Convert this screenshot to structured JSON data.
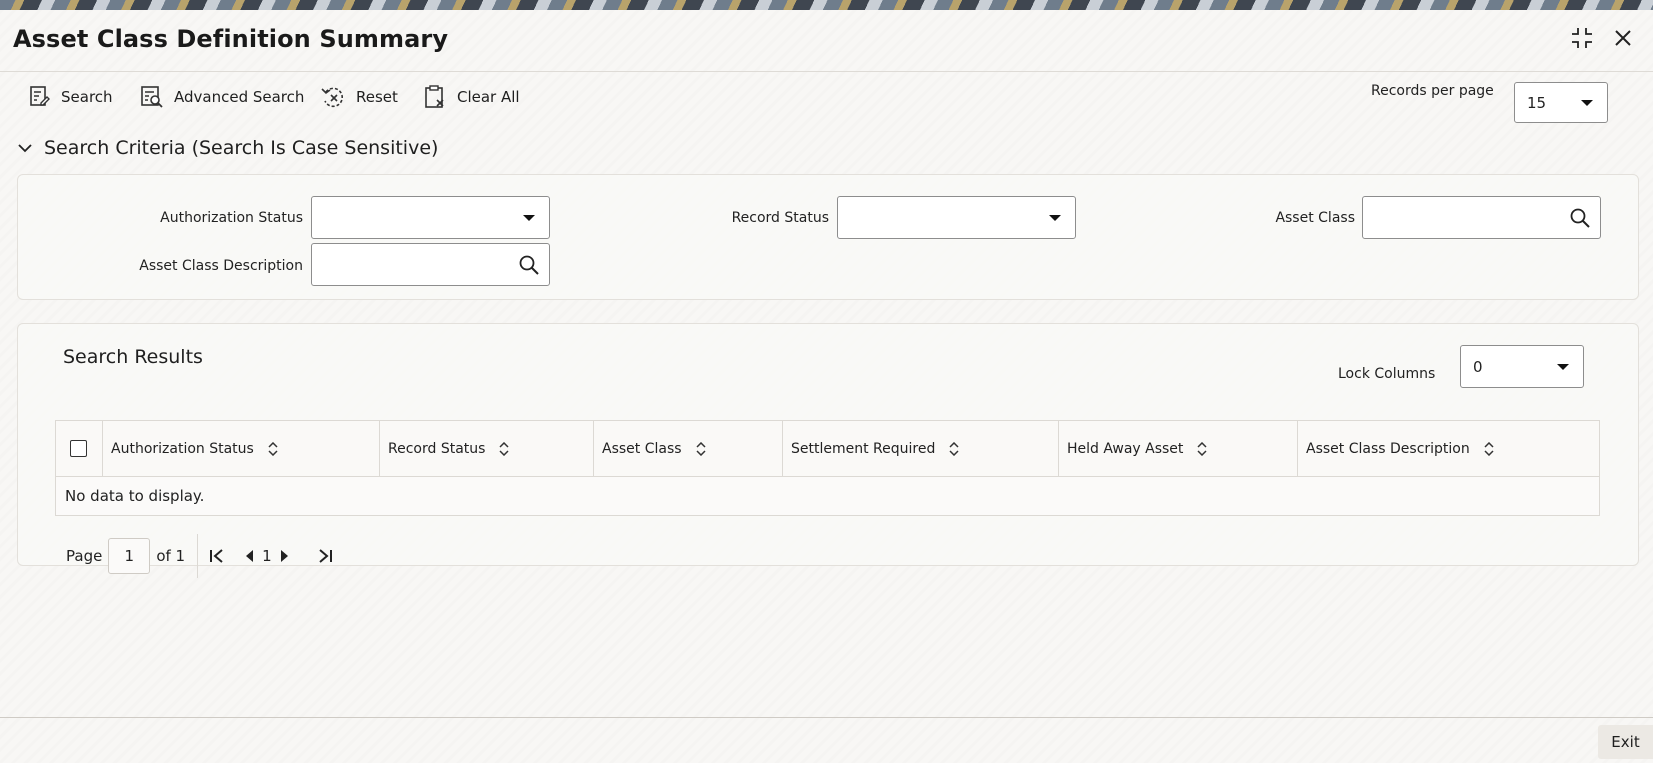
{
  "window": {
    "title": "Asset Class Definition Summary"
  },
  "toolbar": {
    "search_label": "Search",
    "advanced_search_label": "Advanced Search",
    "reset_label": "Reset",
    "clear_all_label": "Clear All",
    "records_per_page_label": "Records per page",
    "records_per_page_value": "15"
  },
  "criteria": {
    "heading": "Search Criteria (Search Is Case Sensitive)",
    "authorization_status_label": "Authorization Status",
    "authorization_status_value": "",
    "record_status_label": "Record Status",
    "record_status_value": "",
    "asset_class_label": "Asset Class",
    "asset_class_value": "",
    "asset_class_description_label": "Asset Class Description",
    "asset_class_description_value": ""
  },
  "results": {
    "heading": "Search Results",
    "lock_columns_label": "Lock Columns",
    "lock_columns_value": "0",
    "columns": [
      "Authorization Status",
      "Record Status",
      "Asset Class",
      "Settlement Required",
      "Held Away Asset",
      "Asset Class Description"
    ],
    "rows": [],
    "empty_message": "No data to display."
  },
  "pagination": {
    "page_label": "Page",
    "current_page": "1",
    "of_label": "of 1",
    "nav_page": "1"
  },
  "footer": {
    "exit_label": "Exit"
  },
  "icons": {
    "search": "search-icon",
    "advanced_search": "advanced-search-icon",
    "reset": "reset-icon",
    "clear_all": "clear-all-icon",
    "restore": "restore-icon",
    "close": "close-icon",
    "collapse": "chevron-down-icon",
    "sort": "sort-icon",
    "magnifier": "magnifier-icon",
    "first": "first-page-icon",
    "prev": "previous-page-icon",
    "next": "next-page-icon",
    "last": "last-page-icon"
  }
}
